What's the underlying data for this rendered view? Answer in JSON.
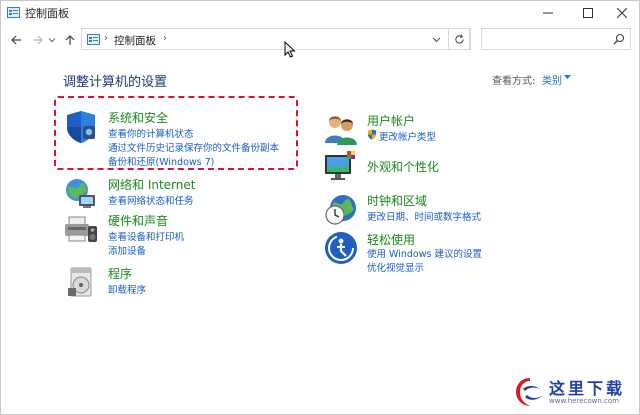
{
  "window": {
    "title": "控制面板",
    "minimize_icon": "minimize-icon",
    "maximize_icon": "maximize-icon",
    "close_icon": "close-icon"
  },
  "nav": {
    "back_icon": "back-arrow-icon",
    "forward_icon": "forward-arrow-icon",
    "recent_icon": "chevron-down-icon",
    "up_icon": "up-arrow-icon",
    "address": {
      "separator": "›",
      "crumb": "控制面板",
      "trailing_separator": "›"
    },
    "refresh_icon": "refresh-icon",
    "search": {
      "placeholder": "",
      "icon": "search-icon"
    }
  },
  "content": {
    "heading": "调整计算机的设置",
    "view_by_label": "查看方式:",
    "view_by_value": "类别",
    "categories_left": [
      {
        "icon": "shield-icon",
        "title": "系统和安全",
        "links": [
          "查看你的计算机状态",
          "通过文件历史记录保存你的文件备份副本",
          "备份和还原(Windows 7)"
        ]
      },
      {
        "icon": "network-globe-icon",
        "title": "网络和 Internet",
        "links": [
          "查看网络状态和任务"
        ]
      },
      {
        "icon": "printer-speaker-icon",
        "title": "硬件和声音",
        "links": [
          "查看设备和打印机",
          "添加设备"
        ]
      },
      {
        "icon": "programs-disc-icon",
        "title": "程序",
        "links": [
          "卸载程序"
        ]
      }
    ],
    "categories_right": [
      {
        "icon": "users-icon",
        "title": "用户帐户",
        "links": [
          "更改帐户类型"
        ]
      },
      {
        "icon": "monitor-palette-icon",
        "title": "外观和个性化",
        "links": []
      },
      {
        "icon": "clock-globe-icon",
        "title": "时钟和区域",
        "links": [
          "更改日期、时间或数字格式"
        ]
      },
      {
        "icon": "accessibility-icon",
        "title": "轻松使用",
        "links": [
          "使用 Windows 建议的设置",
          "优化视觉显示"
        ]
      }
    ]
  },
  "watermark": {
    "text": "这里下载",
    "url": "www.herecown.com"
  },
  "colors": {
    "heading": "#1c3b7a",
    "category_title": "#1a8a1a",
    "link": "#1a5ec9",
    "highlight_border": "#e0112a"
  }
}
